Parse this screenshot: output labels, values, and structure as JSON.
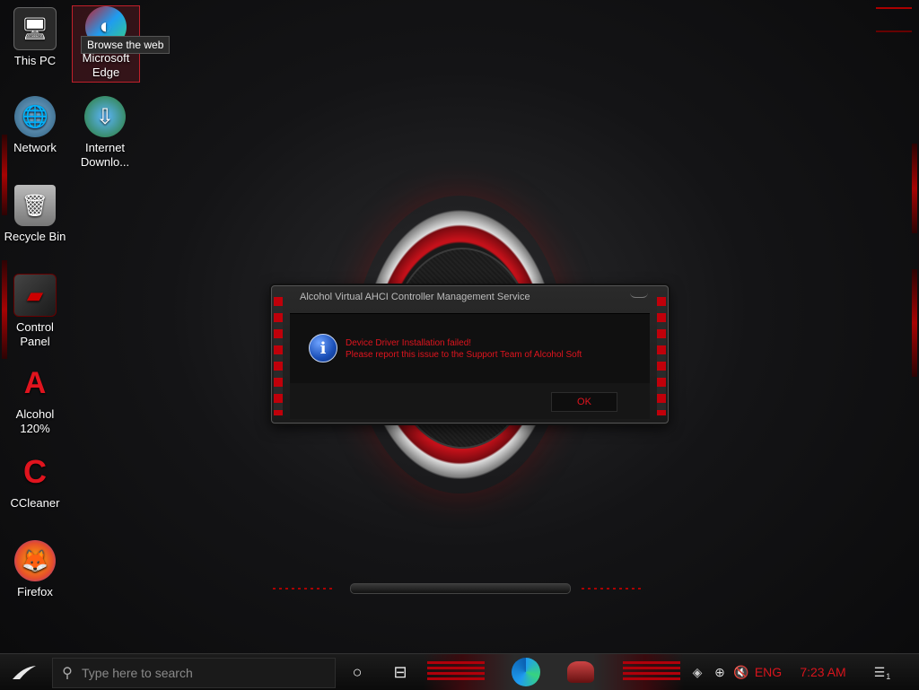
{
  "desktop": {
    "icons": [
      {
        "label": "This PC",
        "glyph": "🖥"
      },
      {
        "label": "Microsoft Edge",
        "glyph": "◐"
      },
      {
        "label": "Network",
        "glyph": "🌐"
      },
      {
        "label": "Internet Downlo...",
        "glyph": "⇩"
      },
      {
        "label": "Recycle Bin",
        "glyph": "🗑"
      },
      {
        "label": "Control Panel",
        "glyph": "▰"
      },
      {
        "label": "Alcohol 120%",
        "glyph": "A"
      },
      {
        "label": "CCleaner",
        "glyph": "C"
      },
      {
        "label": "Firefox",
        "glyph": "🦊"
      }
    ],
    "tooltip": "Browse the web"
  },
  "dialog": {
    "title": "Alcohol Virtual AHCI Controller Management Service",
    "message_line1": "Device Driver Installation failed!",
    "message_line2": "Please report this issue to the Support Team of Alcohol Soft",
    "ok_label": "OK",
    "icon": "info-icon"
  },
  "taskbar": {
    "search_placeholder": "Type here to search",
    "language": "ENG",
    "time": "7:23 AM",
    "notification_count": "1"
  },
  "colors": {
    "accent": "#d8141c",
    "background": "#141416"
  }
}
